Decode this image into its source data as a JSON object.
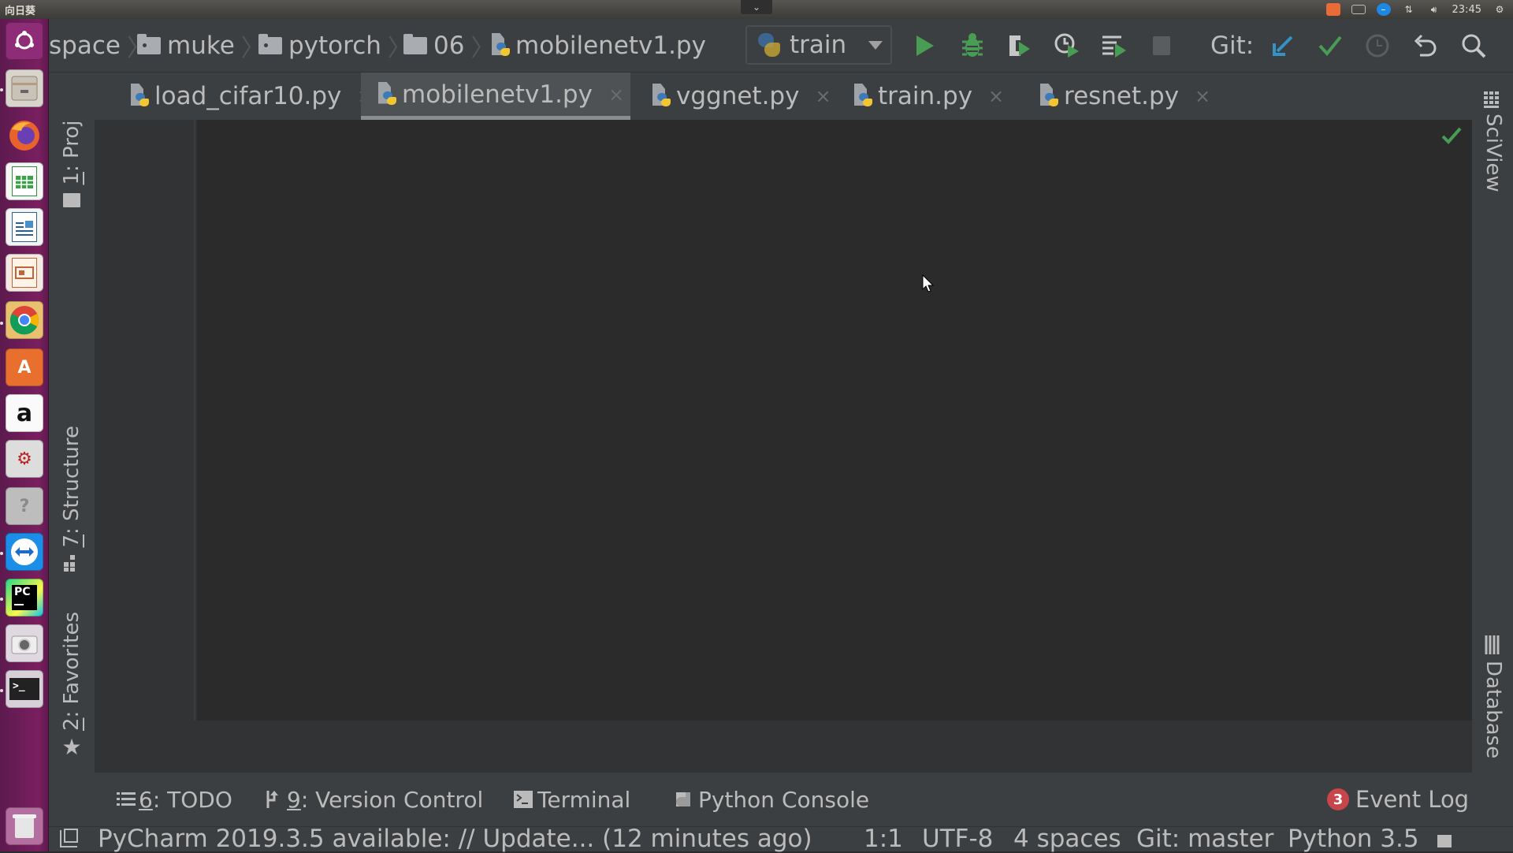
{
  "system_panel": {
    "app_name": "向日葵",
    "clock": "23:45",
    "dropdown_glyph": "⌄",
    "tray_icons": [
      "sunlogin-icon",
      "keyboard-icon",
      "teamviewer-icon",
      "network-icon",
      "volume-icon",
      "power-gear-icon"
    ]
  },
  "launcher": {
    "items": [
      {
        "name": "ubuntu-dash",
        "glyph": "◎"
      },
      {
        "name": "files",
        "glyph": "▭"
      },
      {
        "name": "firefox",
        "glyph": ""
      },
      {
        "name": "libreoffice-calc",
        "glyph": ""
      },
      {
        "name": "libreoffice-writer",
        "glyph": ""
      },
      {
        "name": "libreoffice-impress",
        "glyph": ""
      },
      {
        "name": "chrome",
        "glyph": ""
      },
      {
        "name": "software-center",
        "glyph": "A"
      },
      {
        "name": "amazon",
        "glyph": "a"
      },
      {
        "name": "system-settings",
        "glyph": "⚙"
      },
      {
        "name": "help",
        "glyph": "?"
      },
      {
        "name": "teamviewer",
        "glyph": "⇄"
      },
      {
        "name": "pycharm",
        "glyph": "PC"
      },
      {
        "name": "camera",
        "glyph": "◉"
      },
      {
        "name": "terminal",
        "glyph": ">_"
      }
    ],
    "trash_glyph": "🗑"
  },
  "navbar": {
    "breadcrumb": [
      {
        "label": "space",
        "type": "text"
      },
      {
        "label": "muke",
        "type": "folder"
      },
      {
        "label": "pytorch",
        "type": "folder"
      },
      {
        "label": "06",
        "type": "folder"
      },
      {
        "label": "mobilenetv1.py",
        "type": "python-file"
      }
    ],
    "separator": "〉",
    "run_config": "train",
    "git_label": "Git:",
    "buttons": [
      "run",
      "debug",
      "run-with-coverage",
      "profile",
      "concurrency-diagram",
      "stop",
      "git-update",
      "git-commit",
      "git-history",
      "rollback",
      "search-everywhere"
    ]
  },
  "tabs": [
    {
      "label": "load_cifar10.py",
      "active": false
    },
    {
      "label": "mobilenetv1.py",
      "active": true
    },
    {
      "label": "vggnet.py",
      "active": false
    },
    {
      "label": "train.py",
      "active": false
    },
    {
      "label": "resnet.py",
      "active": false
    }
  ],
  "tab_close_glyph": "×",
  "left_tools": {
    "project": {
      "num": "1",
      "label": ": Project"
    },
    "structure": {
      "num": "7",
      "label": ": Structure"
    },
    "favorites": {
      "num": "2",
      "label": ": Favorites"
    }
  },
  "right_tools": {
    "sciview": "SciView",
    "database": "Database"
  },
  "bottom_tools": {
    "todo": {
      "num": "6",
      "label": ": TODO"
    },
    "vcs": {
      "num": "9",
      "label": ": Version Control"
    },
    "terminal": "Terminal",
    "python_console": "Python Console",
    "event_log": {
      "count": "3",
      "label": "Event Log"
    }
  },
  "status_bar": {
    "message": "PyCharm 2019.3.5 available: // Update... (12 minutes ago)",
    "position": "1:1",
    "encoding": "UTF-8",
    "indent": "4 spaces",
    "branch": "Git: master",
    "interpreter": "Python 3.5"
  },
  "colors": {
    "accent_green": "#499c54",
    "git_update_blue": "#3592c4",
    "badge_red": "#c7454b",
    "launcher_purple": "#7a1f60"
  }
}
